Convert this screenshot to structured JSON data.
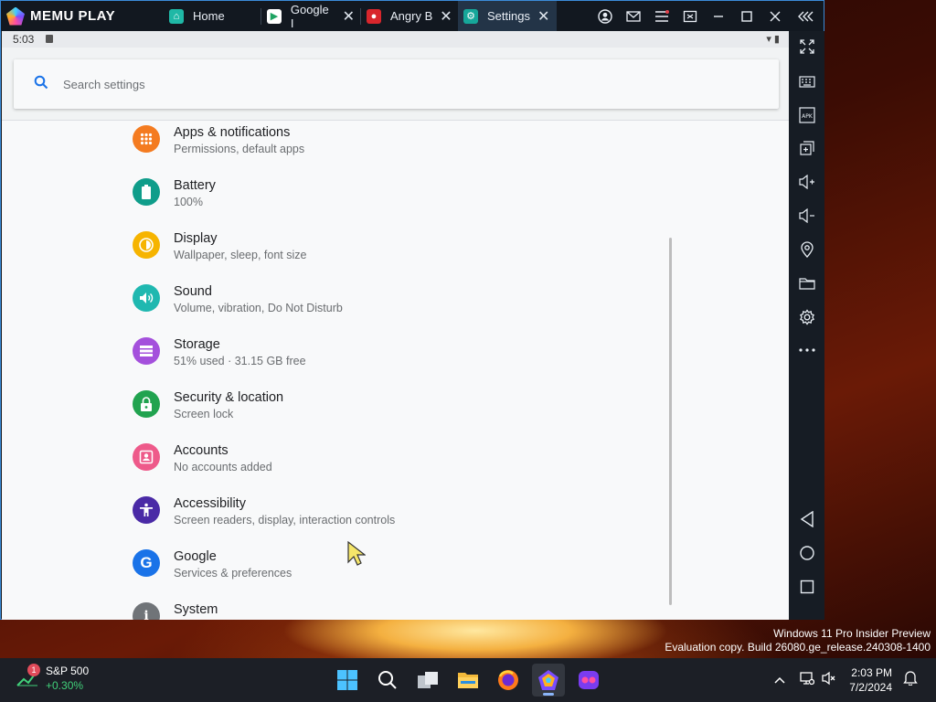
{
  "app": {
    "logo": "MEMU PLAY"
  },
  "tabs": [
    {
      "label": "Home",
      "icon": "memu-home-icon",
      "active": false,
      "closable": false
    },
    {
      "label": "Google I",
      "icon": "play-store-icon",
      "active": false,
      "closable": true
    },
    {
      "label": "Angry B",
      "icon": "angry-birds-icon",
      "active": false,
      "closable": true
    },
    {
      "label": "Settings",
      "icon": "settings-gear-icon",
      "active": true,
      "closable": true
    }
  ],
  "titlebar_buttons": [
    "account-icon",
    "mail-icon",
    "menu-icon",
    "screen-icon",
    "minimize-icon",
    "maximize-icon",
    "close-icon",
    "collapse-sidebar-icon"
  ],
  "sidebar_tools": [
    "fullscreen-icon",
    "keyboard-icon",
    "apk-install-icon",
    "multi-window-icon",
    "volume-up-icon",
    "volume-down-icon",
    "location-icon",
    "folder-icon",
    "settings-icon",
    "more-icon"
  ],
  "android_nav": [
    "back-icon",
    "home-icon",
    "recents-icon"
  ],
  "status_bar": {
    "time": "5:03"
  },
  "search": {
    "placeholder": "Search settings"
  },
  "settings_items": [
    {
      "title": "Apps & notifications",
      "subtitle": "Permissions, default apps",
      "icon": "apps-grid-icon",
      "color": "#f47b20"
    },
    {
      "title": "Battery",
      "subtitle": "100%",
      "icon": "battery-icon",
      "color": "#0f9d8a"
    },
    {
      "title": "Display",
      "subtitle": "Wallpaper, sleep, font size",
      "icon": "brightness-icon",
      "color": "#f6b400"
    },
    {
      "title": "Sound",
      "subtitle": "Volume, vibration, Do Not Disturb",
      "icon": "speaker-icon",
      "color": "#1fb8b0"
    },
    {
      "title": "Storage",
      "subtitle": "51% used · 31.15 GB free",
      "icon": "storage-icon",
      "color": "#a450dc"
    },
    {
      "title": "Security & location",
      "subtitle": "Screen lock",
      "icon": "lock-icon",
      "color": "#21a34f"
    },
    {
      "title": "Accounts",
      "subtitle": "No accounts added",
      "icon": "account-card-icon",
      "color": "#ee5a8a"
    },
    {
      "title": "Accessibility",
      "subtitle": "Screen readers, display, interaction controls",
      "icon": "accessibility-icon",
      "color": "#4a2aa6"
    },
    {
      "title": "Google",
      "subtitle": "Services & preferences",
      "icon": "google-icon",
      "color": "#1a73e8"
    },
    {
      "title": "System",
      "subtitle": "",
      "icon": "info-icon",
      "color": "#707478"
    }
  ],
  "desktop": {
    "watermark_line1": "Windows 11 Pro Insider Preview",
    "watermark_line2": "Evaluation copy. Build 26080.ge_release.240308-1400"
  },
  "taskbar": {
    "widget_title": "S&P 500",
    "widget_value": "+0.30%",
    "widget_badge": "1",
    "apps": [
      "start-icon",
      "search-icon",
      "task-view-icon",
      "file-explorer-icon",
      "firefox-icon",
      "memu-icon",
      "memu-multi-icon"
    ],
    "time": "2:03 PM",
    "date": "7/2/2024"
  }
}
